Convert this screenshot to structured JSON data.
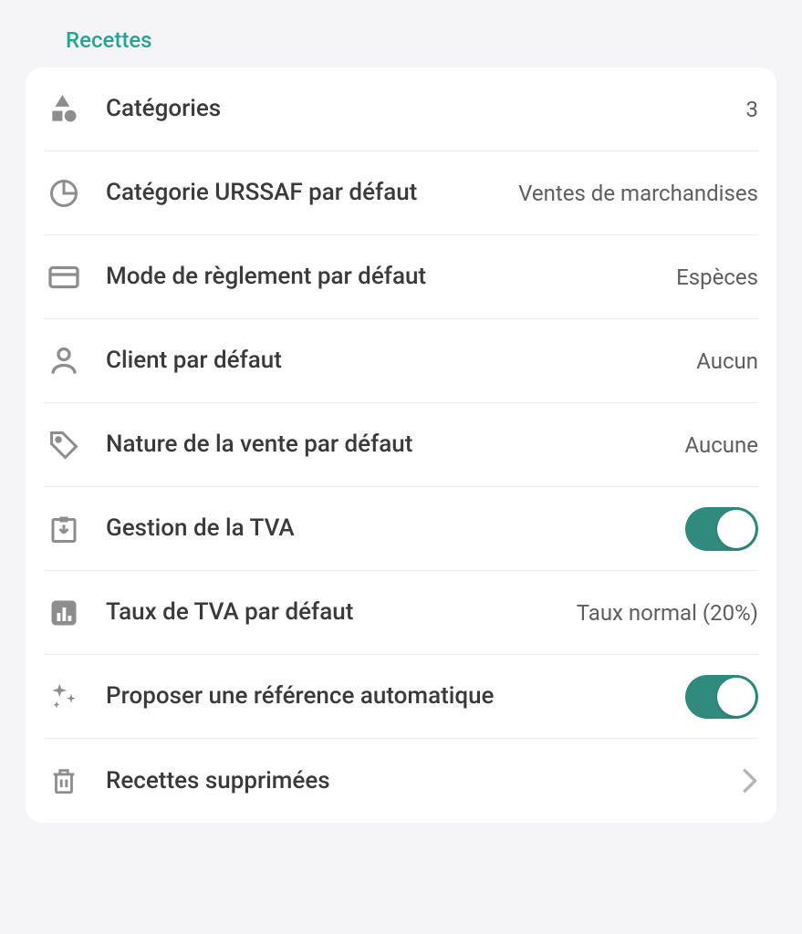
{
  "section": {
    "title": "Recettes"
  },
  "rows": {
    "categories": {
      "label": "Catégories",
      "value": "3"
    },
    "urssaf": {
      "label": "Catégorie URSSAF par défaut",
      "value": "Ventes de marchandises"
    },
    "payment": {
      "label": "Mode de règlement par défaut",
      "value": "Espèces"
    },
    "client": {
      "label": "Client par défaut",
      "value": "Aucun"
    },
    "nature": {
      "label": "Nature de la vente par défaut",
      "value": "Aucune"
    },
    "tva": {
      "label": "Gestion de la TVA",
      "on": true
    },
    "tvaRate": {
      "label": "Taux de TVA par défaut",
      "value": "Taux normal (20%)"
    },
    "autoref": {
      "label": "Proposer une référence automatique",
      "on": true
    },
    "deleted": {
      "label": "Recettes supprimées"
    }
  }
}
